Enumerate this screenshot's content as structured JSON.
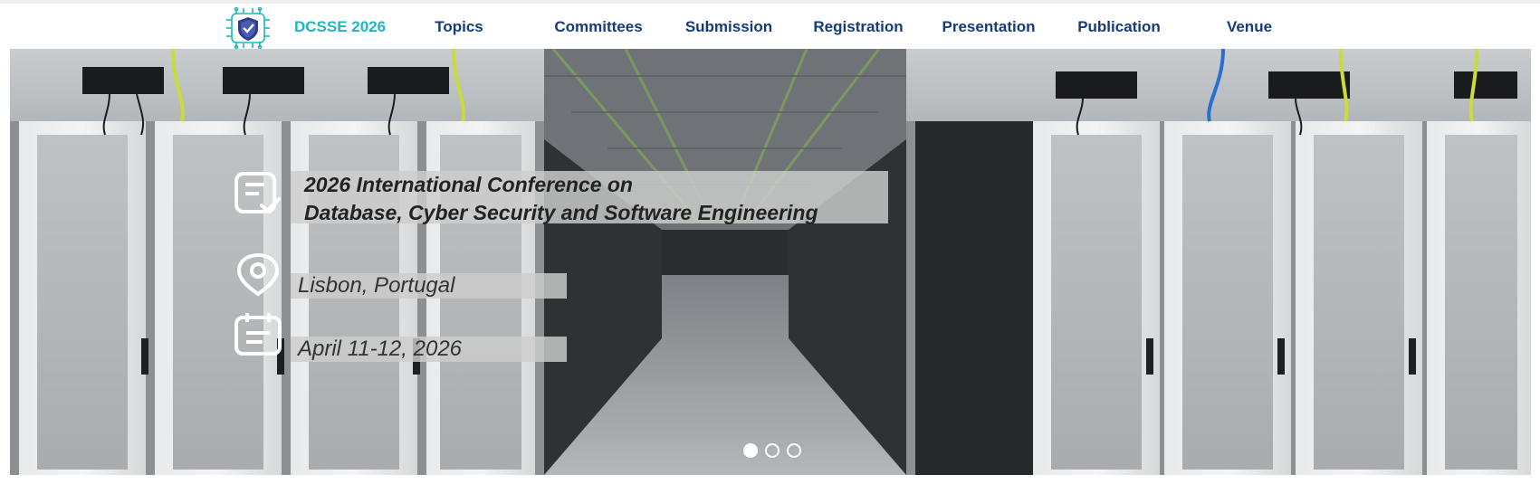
{
  "brand": {
    "name": "DCSSE 2026"
  },
  "nav": {
    "items": [
      {
        "label": "Topics"
      },
      {
        "label": "Committees"
      },
      {
        "label": "Submission"
      },
      {
        "label": "Registration"
      },
      {
        "label": "Presentation"
      },
      {
        "label": "Publication"
      },
      {
        "label": "Venue"
      }
    ]
  },
  "hero": {
    "title_line1": "2026 International Conference on",
    "title_line2": "Database, Cyber Security and Software Engineering",
    "location": "Lisbon, Portugal",
    "date": "April 11-12, 2026",
    "slides": {
      "count": 3,
      "active": 1
    }
  },
  "colors": {
    "brand": "#1fb6c1",
    "nav_text": "#173a78",
    "logo_shield": "#2c3e8c"
  },
  "icons": {
    "logo": "shield-chip-icon",
    "title": "document-check-icon",
    "location": "map-pin-icon",
    "date": "calendar-icon"
  }
}
